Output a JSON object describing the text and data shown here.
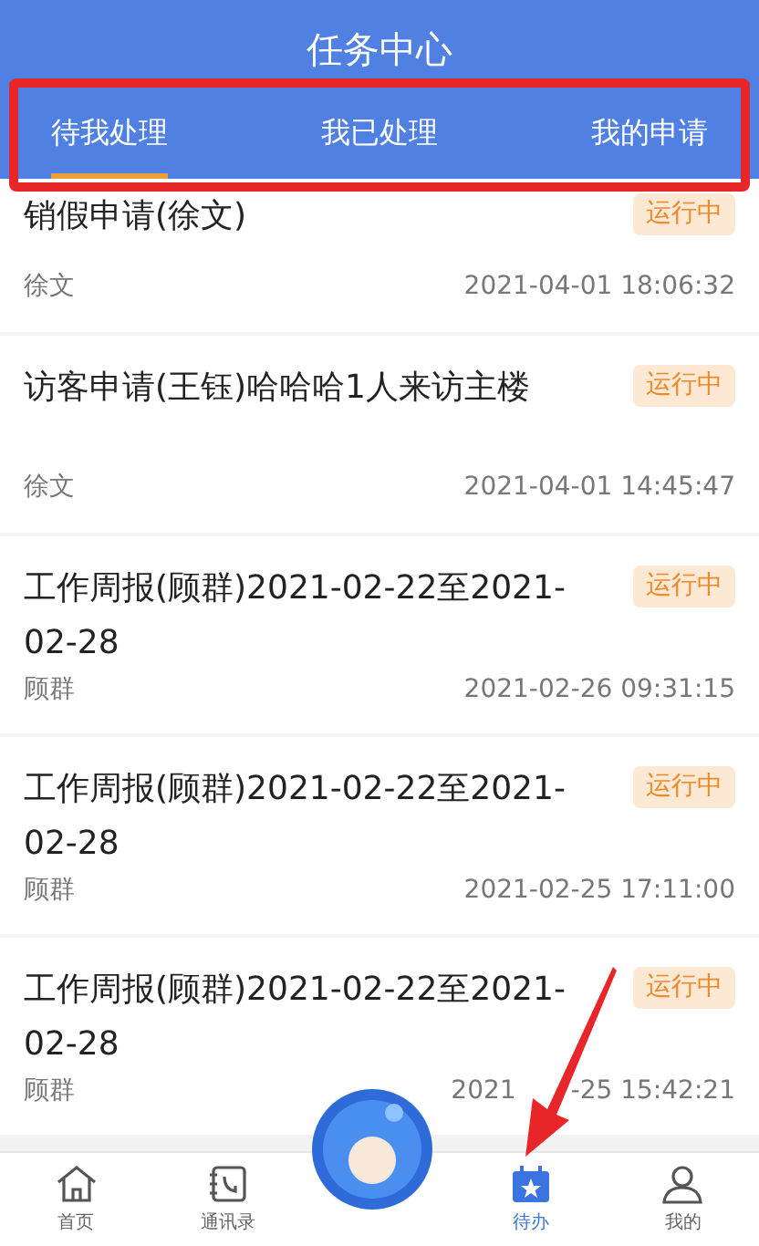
{
  "header": {
    "title": "任务中心"
  },
  "tabs": [
    {
      "label": "待我处理",
      "selected": true
    },
    {
      "label": "我已处理",
      "selected": false
    },
    {
      "label": "我的申请",
      "selected": false
    }
  ],
  "tasks": [
    {
      "title": "销假申请(徐文)",
      "status": "运行中",
      "person": "徐文",
      "date_parts": [
        "2021-04-01 18:06:32"
      ]
    },
    {
      "title": "访客申请(王钰)哈哈哈1人来访主楼",
      "status": "运行中",
      "person": "徐文",
      "date_parts": [
        "2021-04-01 14:45:47"
      ]
    },
    {
      "title": "工作周报(顾群)2021-02-22至2021-02-28",
      "status": "运行中",
      "person": "顾群",
      "date_parts": [
        "2021-02-26 09:31:15"
      ]
    },
    {
      "title": "工作周报(顾群)2021-02-22至2021-02-28",
      "status": "运行中",
      "person": "顾群",
      "date_parts": [
        "2021-02-25 17:11:00"
      ]
    },
    {
      "title": "工作周报(顾群)2021-02-22至2021-02-28",
      "status": "运行中",
      "person": "顾群",
      "date_parts": [
        "2021",
        "-25 15:42:21"
      ]
    }
  ],
  "nav": [
    {
      "kind": "home",
      "label": "首页",
      "selected": false
    },
    {
      "kind": "contacts",
      "label": "通讯录",
      "selected": false
    },
    {
      "kind": "mascot"
    },
    {
      "kind": "todo",
      "label": "待办",
      "selected": true
    },
    {
      "kind": "user",
      "label": "我的",
      "selected": false
    }
  ]
}
